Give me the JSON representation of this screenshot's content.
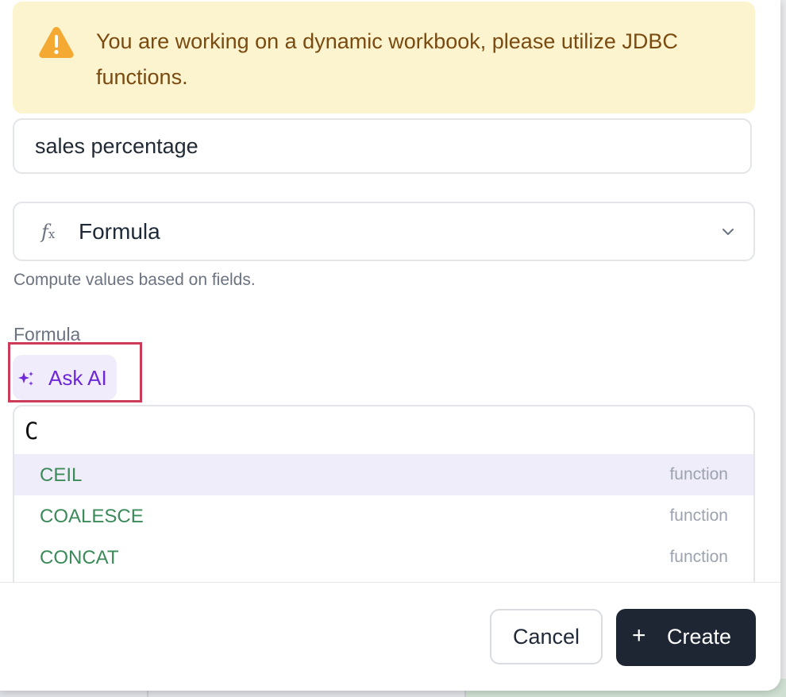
{
  "alert": {
    "text": "You are working on a dynamic workbook, please utilize JDBC functions.",
    "icon": "warning-icon",
    "color": "#f4a932"
  },
  "field_name": {
    "value": "sales percentage"
  },
  "type_select": {
    "icon": "function-icon",
    "label": "Formula",
    "helper": "Compute values based on fields."
  },
  "formula": {
    "label": "Formula",
    "ask_ai_label": "Ask AI",
    "editor_value": "C",
    "suggestions": [
      {
        "name": "CEIL",
        "kind": "function"
      },
      {
        "name": "COALESCE",
        "kind": "function"
      },
      {
        "name": "CONCAT",
        "kind": "function"
      }
    ]
  },
  "footer": {
    "cancel_label": "Cancel",
    "create_label": "Create"
  },
  "colors": {
    "accent_purple": "#6d28d9",
    "suggestion_green": "#3b8a5a",
    "primary_button": "#1e2633"
  }
}
